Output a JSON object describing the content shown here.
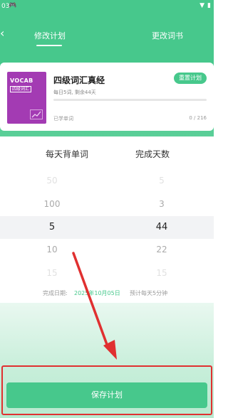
{
  "status_bar": {
    "time": "03",
    "game_icon": "gamepad-icon",
    "icons": [
      "wifi-icon",
      "battery-icon"
    ]
  },
  "header": {
    "back_icon": "chevron-left-icon",
    "tabs": [
      {
        "label": "修改计划",
        "active": true
      },
      {
        "label": "更改词书",
        "active": false
      }
    ]
  },
  "book": {
    "cover": {
      "vocab_text": "VOCAB",
      "tag_text": "四级词汇",
      "color": "#a33bb3",
      "icon": "trend-chart-icon"
    },
    "title": "四级词汇真经",
    "reset_label": "重置计划",
    "plan_subtitle": "每日5词, 剩余44天",
    "progress_fraction": 0.0,
    "learned_label": "已学单词",
    "learned_count": "0 / 216"
  },
  "picker": {
    "left_header": "每天背单词",
    "right_header": "完成天数",
    "left_values": [
      "50",
      "100",
      "5",
      "10",
      "15"
    ],
    "right_values": [
      "5",
      "3",
      "44",
      "22",
      "15"
    ],
    "selected_index": 2
  },
  "info": {
    "finish_label": "完成日期:",
    "finish_date": "2025年10月05日",
    "estimate": "预计每天5分钟"
  },
  "save_label": "保存计划",
  "colors": {
    "primary": "#47c88c",
    "annotation": "#e03030"
  }
}
